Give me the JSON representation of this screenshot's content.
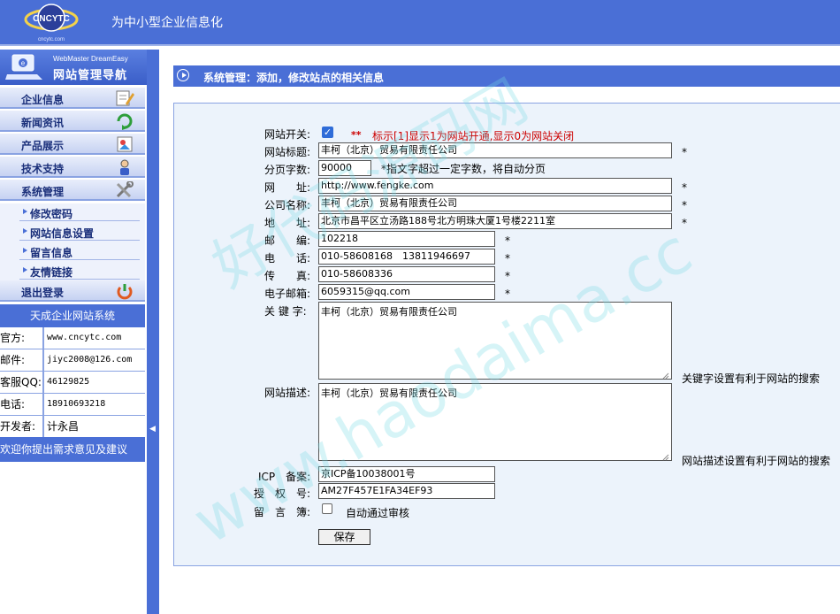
{
  "header": {
    "logo_text": "CNCYTC",
    "logo_subtext": "cncytc.com",
    "slogan": "为中小型企业信息化"
  },
  "sidebar": {
    "brand_en": "WebMaster DreamEasy",
    "brand_cn": "网站管理导航",
    "menu": [
      {
        "label": "企业信息",
        "icon": "edit-icon"
      },
      {
        "label": "新闻资讯",
        "icon": "refresh-arrow-icon"
      },
      {
        "label": "产品展示",
        "icon": "image-icon"
      },
      {
        "label": "技术支持",
        "icon": "user-icon"
      },
      {
        "label": "系统管理",
        "icon": "tools-icon"
      }
    ],
    "submenu": [
      {
        "label": "修改密码"
      },
      {
        "label": "网站信息设置"
      },
      {
        "label": "留言信息"
      },
      {
        "label": "友情链接"
      }
    ],
    "logout": {
      "label": "退出登录",
      "icon": "logout-icon"
    },
    "system_title": "天成企业网站系统",
    "info": [
      {
        "key": "官方:",
        "value": "www.cncytc.com"
      },
      {
        "key": "邮件:",
        "value": "jiyc2008@126.com"
      },
      {
        "key": "客服QQ:",
        "value": "46129825"
      },
      {
        "key": "电话:",
        "value": "18910693218"
      },
      {
        "key": "开发者:",
        "value": "计永昌"
      }
    ],
    "suggest": "欢迎你提出需求意见及建议"
  },
  "main": {
    "title": "系统管理：添加，修改站点的相关信息",
    "form": {
      "site_switch": {
        "label": "网站开关:",
        "checked": true,
        "note_stars": "**",
        "note_text": "标示[1]显示1为网站开通,显示0为网站关闭"
      },
      "site_title": {
        "label": "网站标题:",
        "value": "丰柯（北京）贸易有限责任公司",
        "star": "*"
      },
      "page_chars": {
        "label": "分页字数:",
        "value": "90000",
        "note": "*指文字超过一定字数，将自动分页"
      },
      "url": {
        "label": "网　　址:",
        "value": "http://www.fengke.com",
        "star": "*"
      },
      "company": {
        "label": "公司名称:",
        "value": "丰柯（北京）贸易有限责任公司",
        "star": "*"
      },
      "address": {
        "label": "地　　址:",
        "value": "北京市昌平区立汤路188号北方明珠大厦1号楼2211室",
        "star": "*"
      },
      "postcode": {
        "label": "邮　　编:",
        "value": "102218",
        "star": "*"
      },
      "phone": {
        "label": "电　　话:",
        "value": "010-58608168　13811946697",
        "star": "*"
      },
      "fax": {
        "label": "传　　真:",
        "value": "010-58608336",
        "star": "*"
      },
      "email": {
        "label": "电子邮箱:",
        "value": "6059315@qq.com",
        "star": "*"
      },
      "keywords": {
        "label": "关 键 字:",
        "value": "丰柯（北京）贸易有限责任公司",
        "note": "关键字设置有利于网站的搜索"
      },
      "description": {
        "label": "网站描述:",
        "value": "丰柯（北京）贸易有限责任公司",
        "note": "网站描述设置有利于网站的搜索"
      },
      "icp": {
        "label": "ICP　备案:",
        "value": "京ICP备10038001号"
      },
      "license": {
        "label": "授　权　号:",
        "value": "AM27F457E1FA34EF93"
      },
      "guestbook": {
        "label": "留　言　簿:",
        "checked": false,
        "option": "自动通过审核"
      },
      "save_label": "保存"
    }
  },
  "watermark": {
    "line1": "好代码源码网",
    "line2": "www.haodaima.cc"
  },
  "colors": {
    "primary": "#4a6fd6",
    "panel": "#ecf3fb",
    "note_red": "#cc0000"
  }
}
